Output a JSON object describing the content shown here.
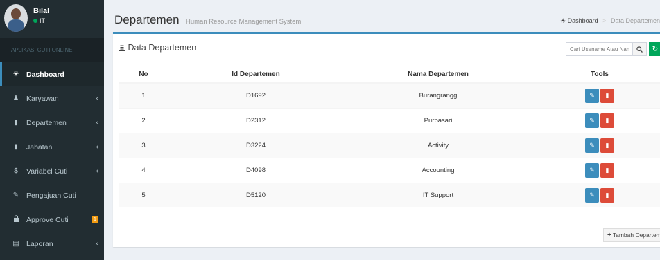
{
  "user": {
    "name": "Bilal",
    "status": "IT"
  },
  "sidebar": {
    "header": "APLIKASI CUTI ONLINE",
    "items": [
      {
        "label": "Dashboard",
        "icon": "dashboard-icon",
        "glyph": "☀"
      },
      {
        "label": "Karyawan",
        "icon": "user-icon",
        "glyph": "♟"
      },
      {
        "label": "Departemen",
        "icon": "book-icon",
        "glyph": "▮"
      },
      {
        "label": "Jabatan",
        "icon": "book-icon",
        "glyph": "▮"
      },
      {
        "label": "Variabel Cuti",
        "icon": "dollar-icon",
        "glyph": "$"
      },
      {
        "label": "Pengajuan Cuti",
        "icon": "edit-icon",
        "glyph": "✎"
      },
      {
        "label": "Approve Cuti",
        "icon": "lock-icon",
        "glyph": "🔒",
        "badge": "1"
      },
      {
        "label": "Laporan",
        "icon": "file-icon",
        "glyph": "▤"
      }
    ]
  },
  "header": {
    "title": "Departemen",
    "subtitle": "Human Resource Management System",
    "breadcrumb_home": "Dashboard",
    "breadcrumb_current": "Data Departemen"
  },
  "box": {
    "title": "Data Departemen",
    "search_placeholder": "Cari Usename Atau Nama",
    "add_label": "Tambah Departemen"
  },
  "table": {
    "headers": [
      "No",
      "Id Departemen",
      "Nama Departemen",
      "Tools"
    ],
    "rows": [
      {
        "no": "1",
        "id": "D1692",
        "nama": "Burangrangg"
      },
      {
        "no": "2",
        "id": "D2312",
        "nama": "Purbasari"
      },
      {
        "no": "3",
        "id": "D3224",
        "nama": "Activity"
      },
      {
        "no": "4",
        "id": "D4098",
        "nama": "Accounting"
      },
      {
        "no": "5",
        "id": "D5120",
        "nama": "IT Support"
      }
    ]
  },
  "colors": {
    "sidebar_bg": "#222d32",
    "accent": "#3c8dbc",
    "danger": "#dd4b39",
    "success": "#00a65a",
    "warning": "#f39c12"
  }
}
